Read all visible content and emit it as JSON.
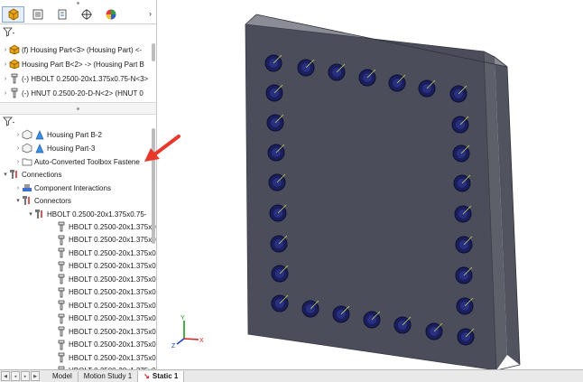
{
  "feature_tree": {
    "top_items": [
      {
        "label": "(f) Housing Part<3> (Housing Part) <-",
        "icon": "part-icon"
      },
      {
        "label": "Housing Part B<2> -> (Housing Part B",
        "icon": "part-icon"
      },
      {
        "label": "(-) HBOLT 0.2500-20x1.375x0.75-N<3>",
        "icon": "bolt-icon"
      },
      {
        "label": "(-) HNUT 0.2500-20-D-N<2> (HNUT 0",
        "icon": "nut-icon"
      }
    ],
    "sim_items": [
      {
        "label": "Housing Part B-2",
        "icon": "solid-body-icon"
      },
      {
        "label": "Housing Part-3",
        "icon": "solid-body-icon"
      },
      {
        "label": "Auto-Converted Toolbox Fastene",
        "icon": "folder-icon"
      },
      {
        "label": "Connections",
        "icon": "connections-icon"
      },
      {
        "label": "Component Interactions",
        "icon": "interaction-icon"
      },
      {
        "label": "Connectors",
        "icon": "connectors-icon"
      },
      {
        "label": "HBOLT 0.2500-20x1.375x0.75-",
        "icon": "bolt-connector-icon"
      }
    ],
    "bolt_items": [
      "HBOLT 0.2500-20x1.375x0",
      "HBOLT 0.2500-20x1.375x0",
      "HBOLT 0.2500-20x1.375x0",
      "HBOLT 0.2500-20x1.375x0",
      "HBOLT 0.2500-20x1.375x0",
      "HBOLT 0.2500-20x1.375x0",
      "HBOLT 0.2500-20x1.375x0",
      "HBOLT 0.2500-20x1.375x0",
      "HBOLT 0.2500-20x1.375x0",
      "HBOLT 0.2500-20x1.375x0",
      "HBOLT 0.2500-20x1.375x0",
      "HBOLT 0.2500-20x1.375x0"
    ],
    "bolt_partial": "HBOLT 0.2500-20x1.375x"
  },
  "bottom_tabs": {
    "model": "Model",
    "motion": "Motion Study 1",
    "static": "Static 1"
  },
  "triad": {
    "x": "X",
    "y": "Y",
    "z": "Z"
  },
  "colors": {
    "plate_front": "#4b4e5a",
    "plate_side": "#5c5f69",
    "plate_top": "#7a7d86",
    "bolt": "#1a1f5c",
    "annotation_arrow": "#e8372b",
    "axis_x": "#d42020",
    "axis_y": "#1a9a1a",
    "axis_z": "#2040c0"
  }
}
